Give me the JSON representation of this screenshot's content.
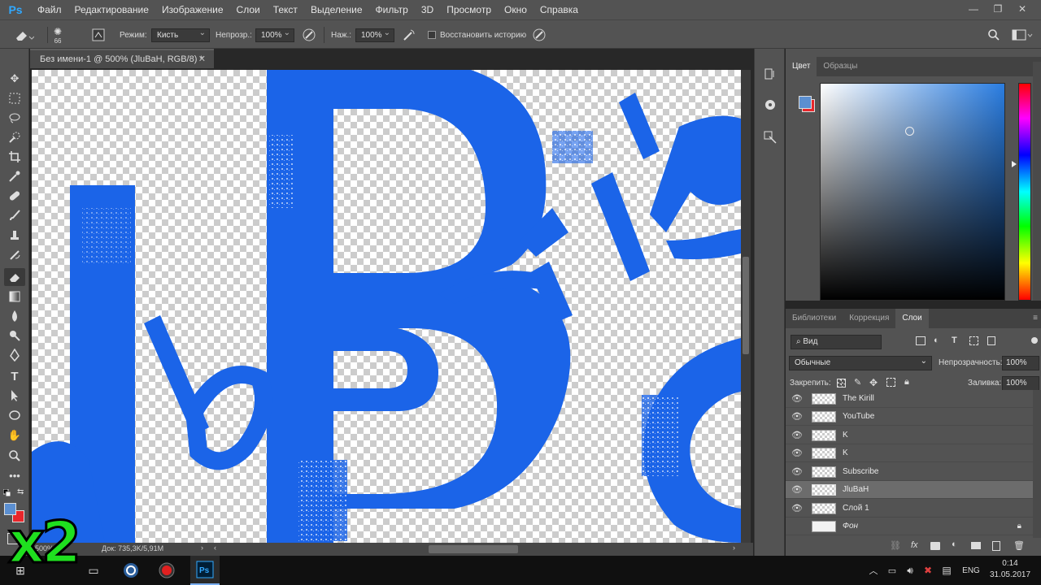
{
  "app": {
    "logo": "Ps"
  },
  "menu": [
    "Файл",
    "Редактирование",
    "Изображение",
    "Слои",
    "Текст",
    "Выделение",
    "Фильтр",
    "3D",
    "Просмотр",
    "Окно",
    "Справка"
  ],
  "window_controls": {
    "minimize_icon": "minimize-icon",
    "restore_icon": "restore-icon",
    "close_icon": "close-icon"
  },
  "options": {
    "brush_size": "66",
    "mode_label": "Режим:",
    "mode_value": "Кисть",
    "opacity_label": "Непрозр.:",
    "opacity_value": "100%",
    "pressure_label": "Наж.:",
    "pressure_value": "100%",
    "history_label": "Восстановить историю"
  },
  "document": {
    "tab_title": "Без имени-1 @ 500% (JluBaH, RGB/8) *",
    "zoom": "500%",
    "doc_size": "Док: 735,3K/5,91M",
    "canvas_fill": "#1b64e8"
  },
  "color_panel": {
    "tabs": [
      "Цвет",
      "Образцы"
    ],
    "fg_color": "#5b8fd1",
    "bg_color": "#e8262b"
  },
  "layers_panel": {
    "tabs": [
      "Библиотеки",
      "Коррекция",
      "Слои"
    ],
    "filter_label": "Вид",
    "blend_mode": "Обычные",
    "opacity_label": "Непрозрачность:",
    "opacity_value": "100%",
    "lock_label": "Закрепить:",
    "fill_label": "Заливка:",
    "fill_value": "100%",
    "layers": [
      {
        "name": "The Kirill",
        "visible": true,
        "selected": false
      },
      {
        "name": "YouTube",
        "visible": true,
        "selected": false
      },
      {
        "name": "K",
        "visible": true,
        "selected": false
      },
      {
        "name": "K",
        "visible": true,
        "selected": false
      },
      {
        "name": "Subscribe",
        "visible": true,
        "selected": false
      },
      {
        "name": "JluBaH",
        "visible": true,
        "selected": true
      },
      {
        "name": "Слой 1",
        "visible": true,
        "selected": false
      },
      {
        "name": "Фон",
        "visible": false,
        "selected": false
      }
    ]
  },
  "overlay_text": "x2",
  "taskbar": {
    "language": "ENG",
    "time": "0:14",
    "date": "31.05.2017"
  }
}
